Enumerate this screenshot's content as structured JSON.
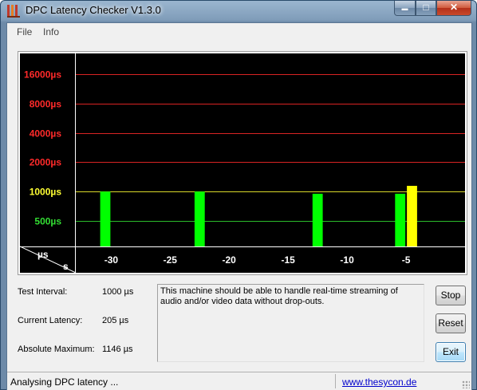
{
  "window": {
    "title": "DPC Latency Checker V1.3.0",
    "minimize_glyph": "▬",
    "maximize_glyph": "□",
    "close_glyph": "✕"
  },
  "menu": {
    "items": [
      "File",
      "Info"
    ]
  },
  "chart_data": {
    "type": "bar",
    "title": "",
    "y_unit_label": "µs",
    "x_unit_label": "s",
    "y_scale": "log",
    "y_gridlines": [
      {
        "value": 16000,
        "label": "16000µs",
        "color": "#ff2a2a"
      },
      {
        "value": 8000,
        "label": "8000µs",
        "color": "#ff2a2a"
      },
      {
        "value": 4000,
        "label": "4000µs",
        "color": "#ff2a2a"
      },
      {
        "value": 2000,
        "label": "2000µs",
        "color": "#ff2a2a"
      },
      {
        "value": 1000,
        "label": "1000µs",
        "color": "#ffff33"
      },
      {
        "value": 500,
        "label": "500µs",
        "color": "#33dd33"
      }
    ],
    "x_ticks": [
      -30,
      -25,
      -20,
      -15,
      -10,
      -5
    ],
    "x_range": [
      -32.5,
      0
    ],
    "bar_colors": {
      "normal": "#00ff00",
      "warning": "#ffff00"
    },
    "series": [
      {
        "values": [
          205,
          180,
          1000,
          205,
          190,
          180,
          185,
          200,
          190,
          215,
          1000,
          205,
          205,
          210,
          195,
          210,
          270,
          195,
          205,
          215,
          950,
          195,
          195,
          200,
          200,
          205,
          205,
          950,
          1146,
          205,
          205,
          180,
          205
        ],
        "status": [
          "normal",
          "normal",
          "normal",
          "normal",
          "normal",
          "normal",
          "normal",
          "normal",
          "normal",
          "normal",
          "normal",
          "normal",
          "normal",
          "normal",
          "normal",
          "normal",
          "normal",
          "normal",
          "normal",
          "normal",
          "normal",
          "normal",
          "normal",
          "normal",
          "normal",
          "normal",
          "normal",
          "normal",
          "warning",
          "normal",
          "normal",
          "normal",
          "normal"
        ]
      }
    ]
  },
  "info": {
    "test_interval_label": "Test Interval:",
    "test_interval_value": "1000 µs",
    "current_latency_label": "Current Latency:",
    "current_latency_value": "205 µs",
    "absolute_maximum_label": "Absolute Maximum:",
    "absolute_maximum_value": "1146 µs",
    "message": "This machine should be able to handle real-time streaming of audio and/or video data without drop-outs."
  },
  "buttons": {
    "stop": "Stop",
    "reset": "Reset",
    "exit": "Exit"
  },
  "status": {
    "text": "Analysing DPC latency ...",
    "link": "www.thesycon.de"
  }
}
